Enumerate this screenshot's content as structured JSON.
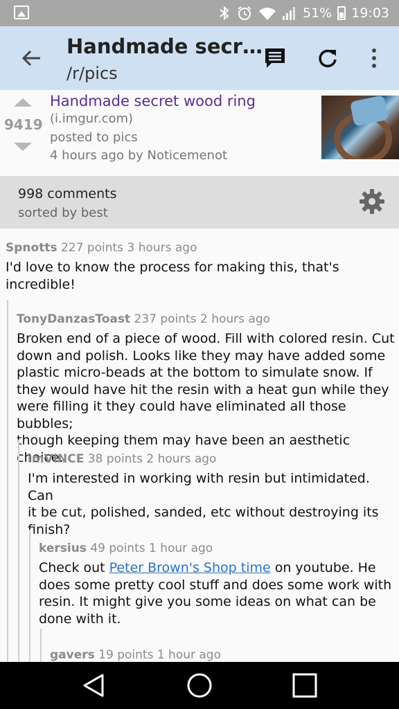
{
  "status": {
    "battery": "51%",
    "time": "19:03"
  },
  "appbar": {
    "title": "Handmade secr…",
    "subtitle": "/r/pics",
    "icons": [
      "back-arrow-icon",
      "comment-icon",
      "refresh-icon",
      "overflow-menu-icon"
    ]
  },
  "post": {
    "score": "9419",
    "title": "Handmade secret wood ring",
    "domain": "(i.imgur.com)",
    "posted_to": "posted to pics",
    "meta": "4 hours ago by Noticemenot"
  },
  "comments_bar": {
    "count": "998 comments",
    "sort": "sorted by best"
  },
  "comments": [
    {
      "author": "Spnotts",
      "points": "227 points",
      "time": "3 hours ago",
      "lines": [
        "I'd love to know the process for making this, that's",
        "incredible!"
      ]
    },
    {
      "author": "TonyDanzasToast",
      "points": "237 points",
      "time": "2 hours ago",
      "lines": [
        "Broken end of a piece of wood. Fill with colored resin. Cut",
        "down and polish. Looks like they may have added some",
        "plastic micro-beads at the bottom to simulate snow. If",
        "they would have hit the resin with a heat gun while they",
        "were filling it they could have eliminated all those bubbles;",
        "though keeping them may have been an aesthetic choice."
      ]
    },
    {
      "author": "imVINCE",
      "points": "38 points",
      "time": "2 hours ago",
      "lines": [
        "I'm interested in working with resin but intimidated. Can",
        "it be cut, polished, sanded, etc without destroying its",
        "finish?"
      ]
    },
    {
      "author": "kersius",
      "points": "49 points",
      "time": "1 hour ago",
      "line1_pre": "Check out ",
      "link": "Peter Brown's Shop time",
      "line1_post": " on youtube. He",
      "lines": [
        "does some pretty cool stuff and does some work with",
        "resin. It might give you some ideas on what can be",
        "done with it."
      ]
    },
    {
      "author": "gavers",
      "points": "19 points",
      "time": "1 hour ago"
    }
  ],
  "colors": {
    "appbar": "#cfe0f2",
    "post_title": "#5b2e91",
    "link": "#2a73c8"
  }
}
